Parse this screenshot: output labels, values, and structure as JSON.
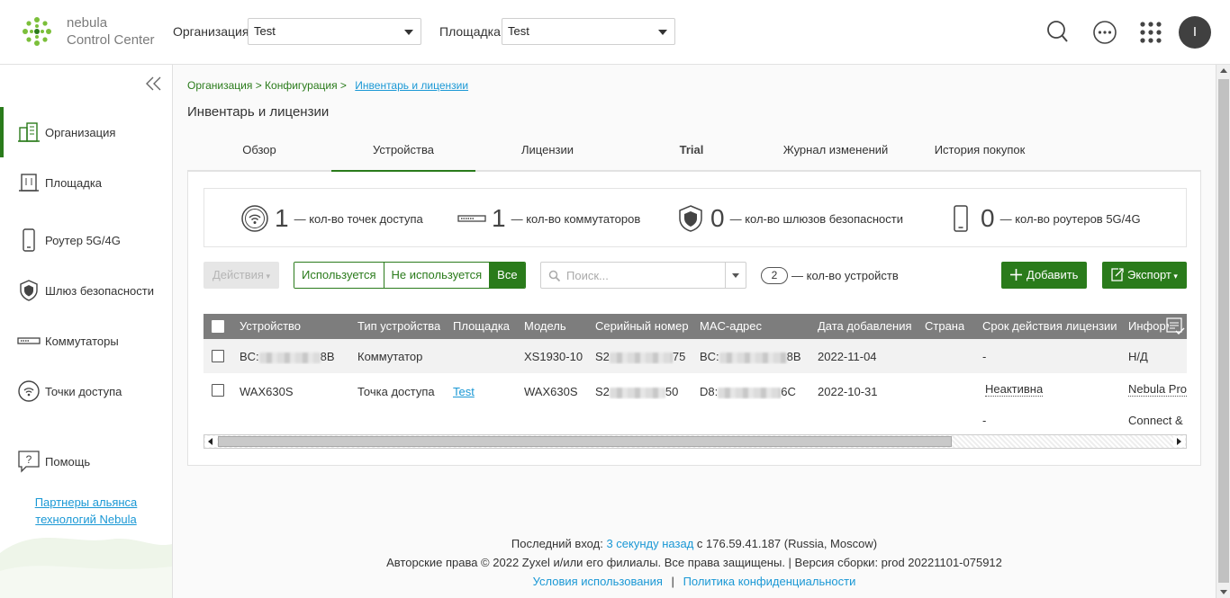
{
  "header": {
    "brand_line1": "nebula",
    "brand_line2": "Control Center",
    "org_label": "Организация:",
    "org_value": "Test",
    "site_label": "Площадка:",
    "site_value": "Test",
    "avatar_letter": "I",
    "icons": [
      "search-icon",
      "more-icon",
      "apps-grid-icon"
    ]
  },
  "sidebar": {
    "items": [
      {
        "label": "Организация",
        "icon": "organization-icon",
        "active": true
      },
      {
        "label": "Площадка",
        "icon": "site-icon"
      },
      {
        "label": "Роутер 5G/4G",
        "icon": "mobile-router-icon"
      },
      {
        "label": "Шлюз безопасности",
        "icon": "shield-icon"
      },
      {
        "label": "Коммутаторы",
        "icon": "switch-icon"
      },
      {
        "label": "Точки доступа",
        "icon": "access-point-icon"
      },
      {
        "label": "Помощь",
        "icon": "help-icon"
      }
    ],
    "partner_line1": "Партнеры альянса",
    "partner_line2": "технологий Nebula"
  },
  "breadcrumb": {
    "part1": "Организация > Конфигурация >",
    "current": "Инвентарь и лицензии"
  },
  "page_title": "Инвентарь и лицензии",
  "tabs": [
    {
      "label": "Обзор"
    },
    {
      "label": "Устройства",
      "active": true
    },
    {
      "label": "Лицензии"
    },
    {
      "label": "Trial",
      "bold": true
    },
    {
      "label": "Журнал изменений"
    },
    {
      "label": "История покупок"
    }
  ],
  "stats": [
    {
      "icon": "access-point-icon",
      "value": "1",
      "text": "— кол-во точек доступа"
    },
    {
      "icon": "switch-icon",
      "value": "1",
      "text": "— кол-во коммутаторов"
    },
    {
      "icon": "shield-icon",
      "value": "0",
      "text": "— кол-во шлюзов безопасности"
    },
    {
      "icon": "mobile-router-icon",
      "value": "0",
      "text": "— кол-во роутеров 5G/4G"
    }
  ],
  "toolbar": {
    "actions_label": "Действия",
    "filter_used": "Используется",
    "filter_unused": "Не используется",
    "filter_all": "Все",
    "search_placeholder": "Поиск...",
    "device_count": "2",
    "device_count_text": "— кол-во устройств",
    "add_label": "Добавить",
    "export_label": "Экспорт"
  },
  "table": {
    "columns": [
      "Устройство",
      "Тип устройства",
      "Площадка",
      "Модель",
      "Серийный номер",
      "MAC-адрес",
      "Дата добавления",
      "Страна",
      "Срок действия лицензии",
      "Информ"
    ],
    "rows": [
      {
        "device_pre": "BC:",
        "device_post": "8B",
        "type": "Коммутатор",
        "site": "",
        "model": "XS1930-10",
        "serial_pre": "S2",
        "serial_post": "75",
        "mac_pre": "BC:",
        "mac_post": "8B",
        "date": "2022-11-04",
        "country": "",
        "license": "-",
        "info": "Н/Д"
      },
      {
        "device": "WAX630S",
        "type": "Точка доступа",
        "site": "Test",
        "model": "WAX630S",
        "serial_pre": "S2",
        "serial_post": "50",
        "mac_pre": "D8:",
        "mac_post": "6C",
        "date": "2022-10-31",
        "country": "",
        "license": "Неактивна",
        "license2": "-",
        "info": "Nebula Pro",
        "info2": "Connect &"
      }
    ]
  },
  "footer": {
    "last_login_label": "Последний вход:",
    "last_login_link": "3 секунду назад",
    "last_login_ip": "с 176.59.41.187 (Russia, Moscow)",
    "copyright": "Авторские права © 2022 Zyxel и/или его филиалы. Все права защищены. | Версия сборки: prod 20221101-075912",
    "terms": "Условия использования",
    "separator": "|",
    "privacy": "Политика конфиденциальности"
  },
  "colors": {
    "brand_green": "#2a7b1b",
    "link_blue": "#1a98d5",
    "header_gray": "#7d7d7d"
  }
}
